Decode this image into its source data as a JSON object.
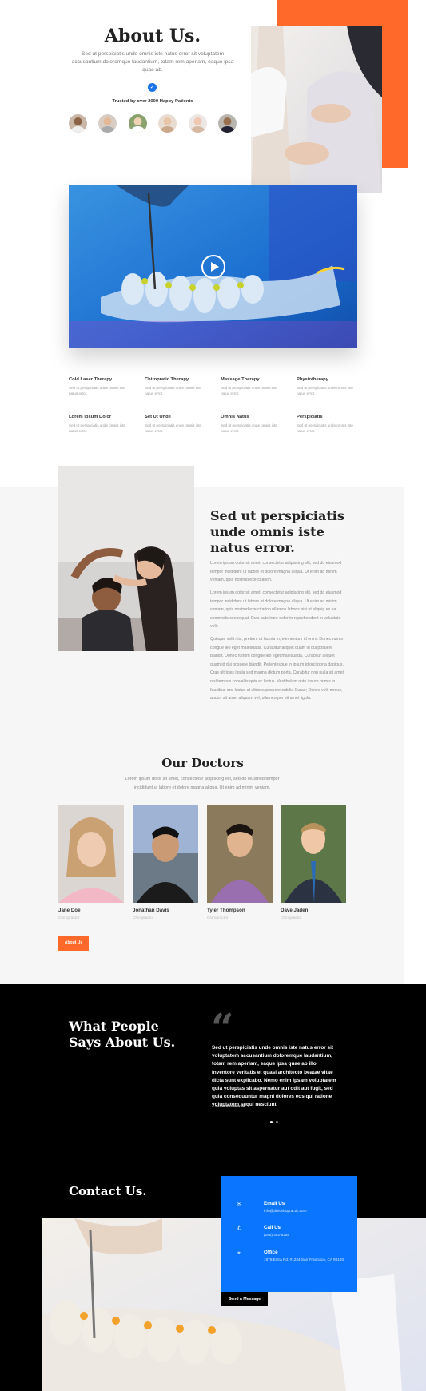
{
  "about": {
    "title": "About Us.",
    "text": "Sed ut perspiciatis unde omnis iste natus error sit voluptatem accusantium doloremque laudantium, totam rem aperiam, eaque ipsa quae ab.",
    "trusted": "Trusted by over 2000 Happy Patients",
    "avatars": [
      "patient-1",
      "patient-2",
      "patient-3",
      "patient-4",
      "patient-5",
      "patient-6"
    ]
  },
  "services": [
    {
      "title": "Cold Laser Therapy",
      "desc": "Sed ut perspiciatis unde omnis iste natus error."
    },
    {
      "title": "Chiropratic Therapy",
      "desc": "Sed ut perspiciatis unde omnis iste natus error."
    },
    {
      "title": "Massage Therapy",
      "desc": "Sed ut perspiciatis unde omnis iste natus error."
    },
    {
      "title": "Physiotherapy",
      "desc": "Sed ut perspiciatis unde omnis iste natus error."
    },
    {
      "title": "Lorem Ipsum Dolor",
      "desc": "Sed ut perspiciatis unde omnis iste natus error."
    },
    {
      "title": "Set Ut Unde",
      "desc": "Sed ut perspiciatis unde omnis iste natus error."
    },
    {
      "title": "Omnis Natus",
      "desc": "Sed ut perspiciatis unde omnis iste natus error."
    },
    {
      "title": "Perspiciatis",
      "desc": "Sed ut perspiciatis unde omnis iste natus error."
    }
  ],
  "intro": {
    "heading": "Sed ut perspiciatis unde omnis iste natus error.",
    "para1": "Lorem ipsum dolor sit amet, consectetur adipiscing elit, sed do eiusmod tempor incididunt ut labore et dolore magna aliqua. Ut enim ad minim veniam, quis nostrud exercitation.",
    "para2": "Lorem ipsum dolor sit amet, consectetur adipiscing elit, sed do eiusmod tempor incididunt ut labore et dolore magna aliqua. Ut enim ad minim veniam, quis nostrud exercitation ullamco laboris nisi ut aliquip ex ea commodo consequat. Duis aute irure dolor in reprehenderit in voluptate velit.",
    "para3": "Quisque velit nisi, pretium ut lacinia in, elementum id enim. Donec rutrum congue leo eget malesuada. Curabitur aliquet quam id dui posuere blandit. Donec rutrum congue leo eget malesuada. Curabitur aliquet quam id dui posuere blandit. Pellentesque in ipsum id orci porta dapibus. Cras ultricies ligula sed magna dictum porta. Curabitur non nulla sit amet nisl tempus convallis quis ac lectus. Vestibulum ante ipsum primis in faucibus orci luctus et ultrices posuere cubilia Curae; Donec velit neque, auctor sit amet aliquam vel, ullamcorper sit amet ligula."
  },
  "doctors": {
    "title": "Our Doctors",
    "text": "Lorem ipsum dolor sit amet, consectetur adipiscing elit, sed do eiusmod tempor incididunt ut labore et dolore magna aliqua. Ut enim ad minim veniam.",
    "items": [
      {
        "name": "Jane Doe",
        "role": "Chiropractor"
      },
      {
        "name": "Jonathan Davis",
        "role": "Chiropractor"
      },
      {
        "name": "Tyler Thompson",
        "role": "Chiropractor"
      },
      {
        "name": "Dave Jaden",
        "role": "Chiropractor"
      }
    ],
    "button": "About Us"
  },
  "testimonial": {
    "heading": "What People Says About Us.",
    "quote_mark": "“",
    "quote": "Sed ut perspiciatis unde omnis iste natus error sit voluptatem accusantium doloremque laudantium, totam rem aperiam, eaque ipsa quae ab illo inventore veritatis et quasi architecto beatae vitae dicta sunt explicabo. Nemo enim ipsam voluptatem quia voluptas sit aspernatur aut odit aut fugit, sed quia consequuntur magni dolores eos qui ratione voluptatem sequi nesciunt.",
    "author": "– Samantha Warner"
  },
  "contact": {
    "heading": "Contact Us.",
    "email_label": "Email Us",
    "email_value": "info@divichiropractic.com",
    "call_label": "Call Us",
    "call_value": "(255) 352-6258",
    "office_label": "Office",
    "office_value": "1678 Extra Rd. #1234 San Francisco, CA 98120",
    "button": "Send a Message"
  },
  "colors": {
    "accent_orange": "#ff6a2b",
    "accent_blue": "#0a76ff",
    "dark": "#000000",
    "light_gray": "#f6f6f6"
  }
}
